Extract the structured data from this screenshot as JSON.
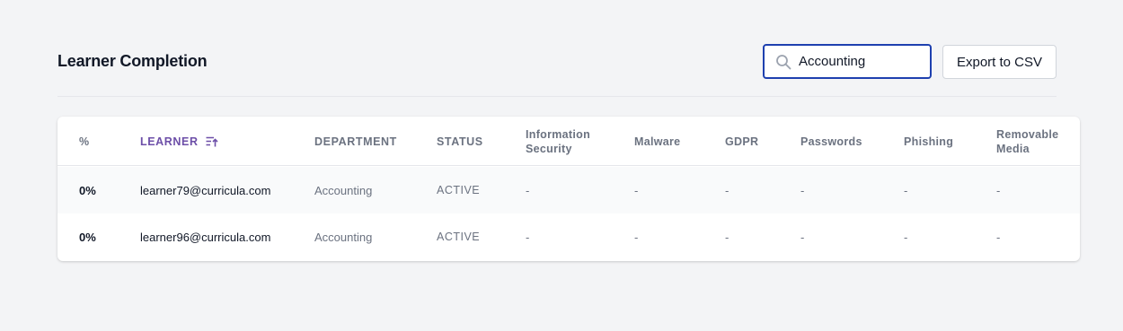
{
  "header": {
    "title": "Learner Completion",
    "search": {
      "value": "Accounting",
      "placeholder": "Search"
    },
    "export_label": "Export to CSV"
  },
  "table": {
    "columns": {
      "pct": "%",
      "learner": "LEARNER",
      "department": "DEPARTMENT",
      "status": "STATUS",
      "info_sec_line1": "Information",
      "info_sec_line2": "Security",
      "malware": "Malware",
      "gdpr": "GDPR",
      "passwords": "Passwords",
      "phishing": "Phishing",
      "removable_line1": "Removable",
      "removable_line2": "Media"
    },
    "sorted_column": "learner",
    "rows": [
      {
        "pct": "0%",
        "learner": "learner79@curricula.com",
        "department": "Accounting",
        "status": "ACTIVE",
        "info_sec": "-",
        "malware": "-",
        "gdpr": "-",
        "passwords": "-",
        "phishing": "-",
        "removable": "-"
      },
      {
        "pct": "0%",
        "learner": "learner96@curricula.com",
        "department": "Accounting",
        "status": "ACTIVE",
        "info_sec": "-",
        "malware": "-",
        "gdpr": "-",
        "passwords": "-",
        "phishing": "-",
        "removable": "-"
      }
    ]
  },
  "colors": {
    "accent_border": "#1e40af",
    "sorted_header": "#6d4fa8",
    "background": "#f3f4f6"
  }
}
